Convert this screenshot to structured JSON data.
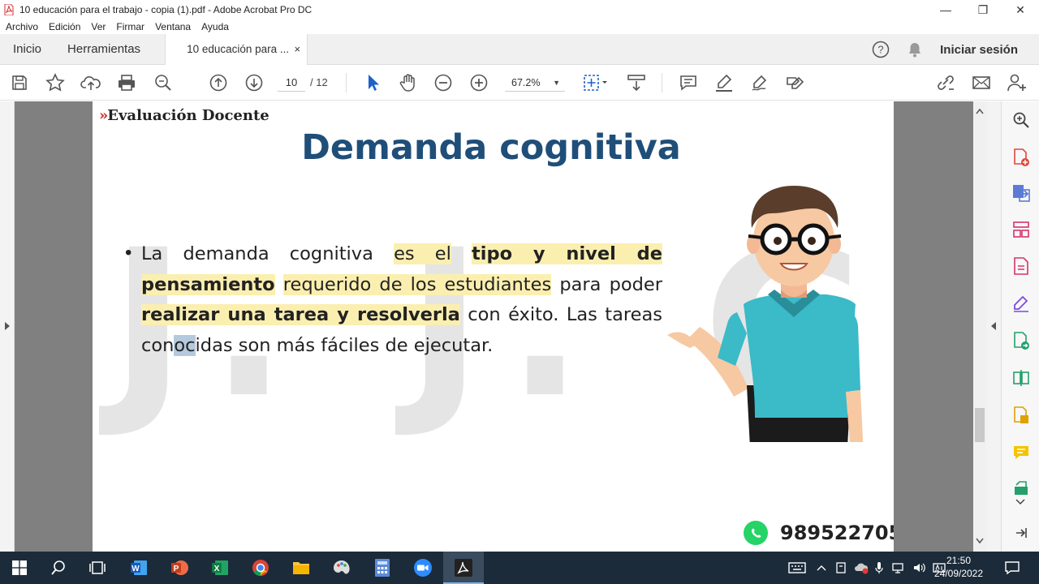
{
  "window": {
    "title": "10 educación para el trabajo - copia (1).pdf - Adobe Acrobat Pro DC",
    "minimize": "—",
    "restore": "❐",
    "close": "✕"
  },
  "menu": [
    "Archivo",
    "Edición",
    "Ver",
    "Firmar",
    "Ventana",
    "Ayuda"
  ],
  "tabs": {
    "home": "Inicio",
    "tools": "Herramientas",
    "document": "10 educación para ...",
    "close": "×"
  },
  "account": {
    "help": "?",
    "signin": "Iniciar sesión"
  },
  "toolbar": {
    "page_current": "10",
    "page_total": "/  12",
    "zoom": "67.2%",
    "zoom_arrow": "▼"
  },
  "slide": {
    "brand_arrows": "»",
    "brand": "Evaluación Docente",
    "title": "Demanda cognitiva",
    "watermark": "J. J. G.",
    "bullet": "•",
    "p1": "La demanda cognitiva",
    "p2": "es el",
    "p3": "tipo y nivel de pensamiento",
    "p4": "requerido de los estudiantes",
    "p5": "para poder",
    "p6": "realizar una tarea y resolverla",
    "p7": "con éxito. Las tareas",
    "p8a": "con",
    "p8b": "oc",
    "p8c": "idas son más fáciles de ejecutar.",
    "phone": "989522705"
  },
  "taskbar": {
    "time": "21:50",
    "date": "24/09/2022"
  },
  "colors": {
    "title_blue": "#1f4e79",
    "highlight": "#fbefb0",
    "acrobat_red": "#d32f2f",
    "whatsapp": "#25d366",
    "taskbar": "#1c2b3a"
  }
}
